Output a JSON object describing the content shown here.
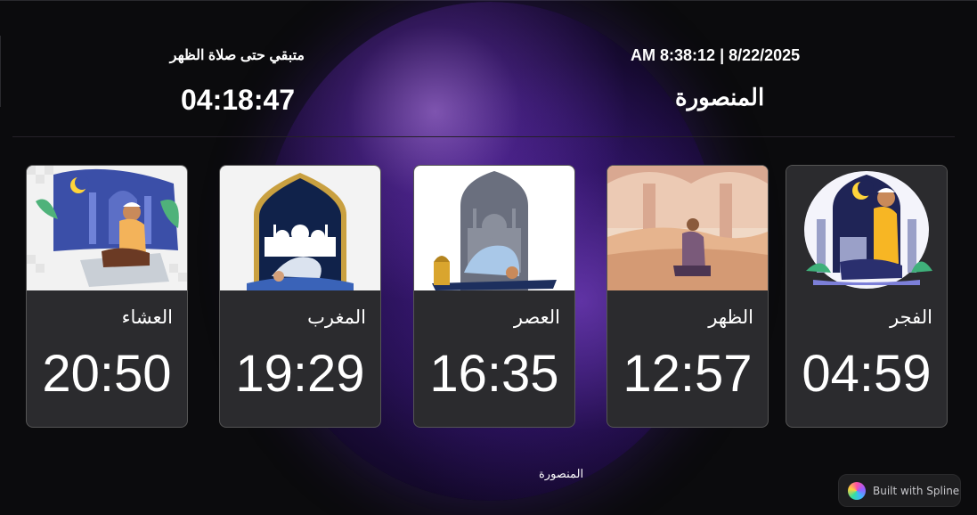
{
  "header": {
    "remaining_label": "متبقي حتى صلاة الظهر",
    "countdown": "04:18:47",
    "datetime": "8/22/2025 | 8:38:12 AM",
    "city": "المنصورة"
  },
  "prayers": [
    {
      "name": "العشاء",
      "time": "20:50"
    },
    {
      "name": "المغرب",
      "time": "19:29"
    },
    {
      "name": "العصر",
      "time": "16:35"
    },
    {
      "name": "الظهر",
      "time": "12:57"
    },
    {
      "name": "الفجر",
      "time": "04:59"
    }
  ],
  "footer": {
    "city": "المنصورة",
    "spline_badge": "Built with Spline"
  }
}
